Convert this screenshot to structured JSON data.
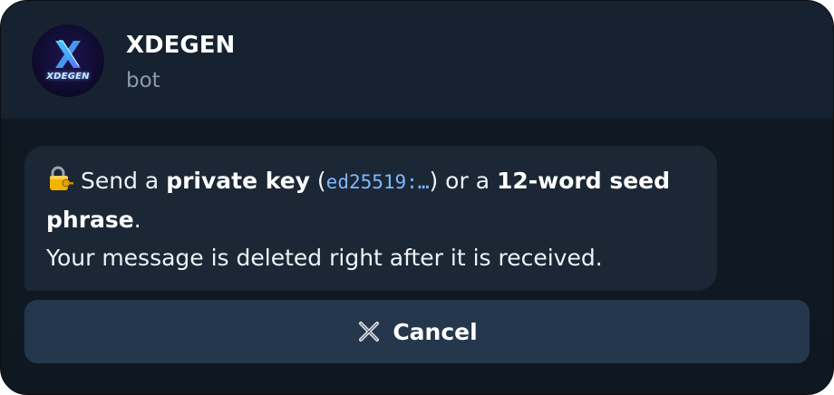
{
  "chat": {
    "title": "XDEGEN",
    "subtitle": "bot",
    "avatar_text": "XDEGEN"
  },
  "message": {
    "lock_icon": "locked-with-key-icon",
    "part1": "Send a ",
    "bold1": "private key",
    "part2": " (",
    "code": "ed25519:…",
    "part3": ") or a ",
    "bold2": "12-word seed phrase",
    "part4": ".",
    "line2": "Your message is deleted right after it is received."
  },
  "actions": {
    "cancel_label": "Cancel",
    "cancel_icon": "cross-mark-icon"
  },
  "colors": {
    "header_bg": "#172230",
    "bubble_bg": "#1b2735",
    "button_bg": "#25374d",
    "code_color": "#7fb8ff",
    "subtitle_color": "#8a99ab"
  }
}
